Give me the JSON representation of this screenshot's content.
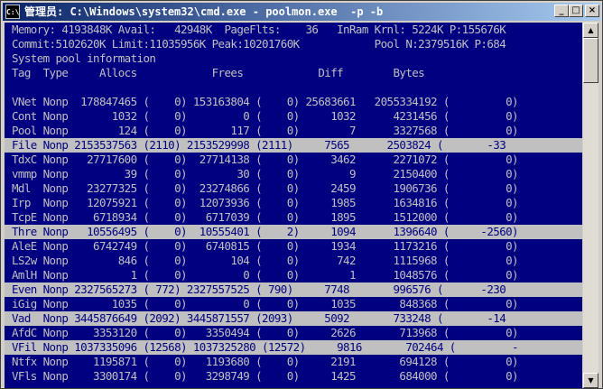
{
  "window": {
    "icon_text": "C:\\",
    "title": "管理员: C:\\Windows\\system32\\cmd.exe - poolmon.exe  -p -b",
    "controls": {
      "minimize": "_",
      "maximize": "□",
      "close": "×"
    }
  },
  "console": {
    "lines": [
      "Memory: 4193848K Avail:   42948K  PageFlts:    36   InRam Krnl: 5224K P:155676K",
      "Commit:5102620K Limit:11035956K Peak:10201760K            Pool N:2379516K P:684",
      "System pool information",
      "Tag  Type     Allocs            Frees            Diff        Bytes",
      "",
      "VNet Nonp  178847465 (    0) 153163804 (    0) 25683661   2055334192 (         0)",
      "Cont Nonp       1032 (    0)         0 (    0)     1032      4231456 (         0)",
      "Pool Nonp        124 (    0)       117 (    0)        7      3327568 (         0)",
      "File Nonp 2153537563 (2110) 2153529998 (2111)     7565      2503824 (       -33",
      "TdxC Nonp   27717600 (    0)  27714138 (    0)     3462      2271072 (         0)",
      "vmmp Nonp         39 (    0)        30 (    0)        9      2150400 (         0)",
      "Mdl  Nonp   23277325 (    0)  23274866 (    0)     2459      1906736 (         0)",
      "Irp  Nonp   12075921 (    0)  12073936 (    0)     1985      1634816 (         0)",
      "TcpE Nonp    6718934 (    0)   6717039 (    0)     1895      1512000 (         0)",
      "Thre Nonp   10556495 (    0)  10555401 (    2)     1094      1396640 (     -2560)",
      "AleE Nonp    6742749 (    0)   6740815 (    0)     1934      1173216 (         0)",
      "LS2w Nonp        846 (    0)       104 (    0)      742      1115968 (         0)",
      "AmlH Nonp          1 (    0)         0 (    0)        1      1048576 (         0)",
      "Even Nonp 2327565273 ( 772) 2327557525 ( 790)     7748       996576 (      -230",
      "iGig Nonp       1035 (    0)         0 (    0)     1035       848368 (         0)",
      "Vad  Nonp 3445876649 (2092) 3445871557 (2093)     5092       733248 (       -14",
      "AfdC Nonp    3353120 (    0)   3350494 (    0)     2626       713968 (         0)",
      "VFil Nonp 1037335096 (12568) 1037325280 (12572)     9816       702464 (         -",
      "Ntfx Nonp    1195871 (    0)   1193680 (    0)     2191       694128 (         0)",
      "VFls Nonp    3300174 (    0)   3298749 (    0)     1425       684000 (         0)"
    ],
    "highlighted_lines": [
      8,
      14,
      18,
      20,
      22
    ],
    "colors": {
      "background": "#000080",
      "text": "#c0c0c0",
      "highlight_bg": "#c0c0c0",
      "highlight_text": "#000080"
    }
  },
  "scrollbar": {
    "up": "▲",
    "down": "▼"
  }
}
